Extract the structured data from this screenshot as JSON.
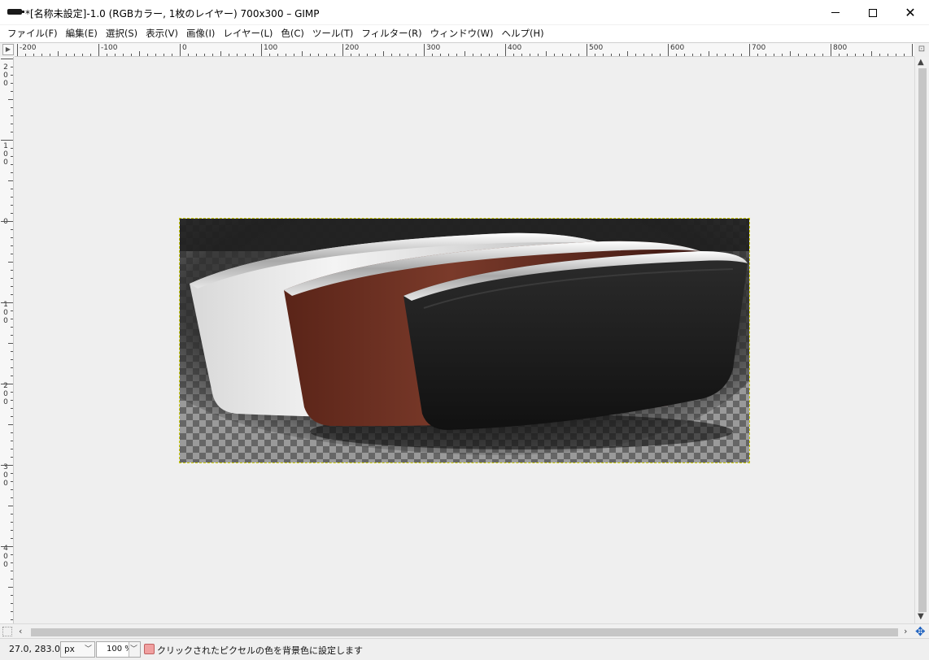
{
  "window": {
    "title": "*[名称未設定]-1.0 (RGBカラー, 1枚のレイヤー) 700x300 – GIMP",
    "minimize_icon": "minimize-icon",
    "maximize_icon": "maximize-icon",
    "close_icon": "close-icon"
  },
  "menu": [
    {
      "label": "ファイル(F)"
    },
    {
      "label": "編集(E)"
    },
    {
      "label": "選択(S)"
    },
    {
      "label": "表示(V)"
    },
    {
      "label": "画像(I)"
    },
    {
      "label": "レイヤー(L)"
    },
    {
      "label": "色(C)"
    },
    {
      "label": "ツール(T)"
    },
    {
      "label": "フィルター(R)"
    },
    {
      "label": "ウィンドウ(W)"
    },
    {
      "label": "ヘルプ(H)"
    }
  ],
  "rulers": {
    "horizontal_labels": [
      "-200",
      "-100",
      "0",
      "100",
      "200",
      "300",
      "400",
      "500",
      "600",
      "700",
      "800"
    ],
    "vertical_labels": [
      "200",
      "100",
      "0",
      "100",
      "200",
      "300",
      "400"
    ]
  },
  "canvas": {
    "image_size": "700x300",
    "background_color": "#efefef",
    "selection_color": "#c8c800"
  },
  "statusbar": {
    "coords": "27.0, 283.0",
    "unit": "px",
    "zoom": "100 %",
    "message": "クリックされたピクセルの色を背景色に設定します"
  }
}
